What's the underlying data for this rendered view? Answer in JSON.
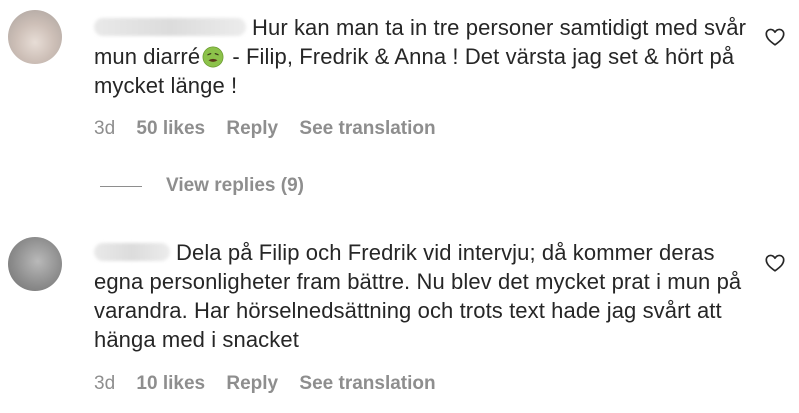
{
  "comments": [
    {
      "text_before_emoji": "Hur kan man ta in tre personer samtidigt med svår mun diarré",
      "emoji": "nauseated-face-icon",
      "text_after_emoji": " - Filip, Fredrik & Anna ! Det värsta jag set & hört på mycket länge !",
      "time": "3d",
      "likes": "50 likes",
      "reply_label": "Reply",
      "translate_label": "See translation",
      "view_replies": "View replies (9)"
    },
    {
      "text": "Dela på Filip och Fredrik vid intervju; då kommer deras egna personligheter fram bättre. Nu blev det mycket prat i mun på varandra. Har hörselnedsättning och trots text hade jag svårt att hänga med i snacket",
      "time": "3d",
      "likes": "10 likes",
      "reply_label": "Reply",
      "translate_label": "See translation"
    }
  ],
  "colors": {
    "text": "#262626",
    "secondary": "#8e8e8e",
    "emoji": "#7fb23a"
  }
}
